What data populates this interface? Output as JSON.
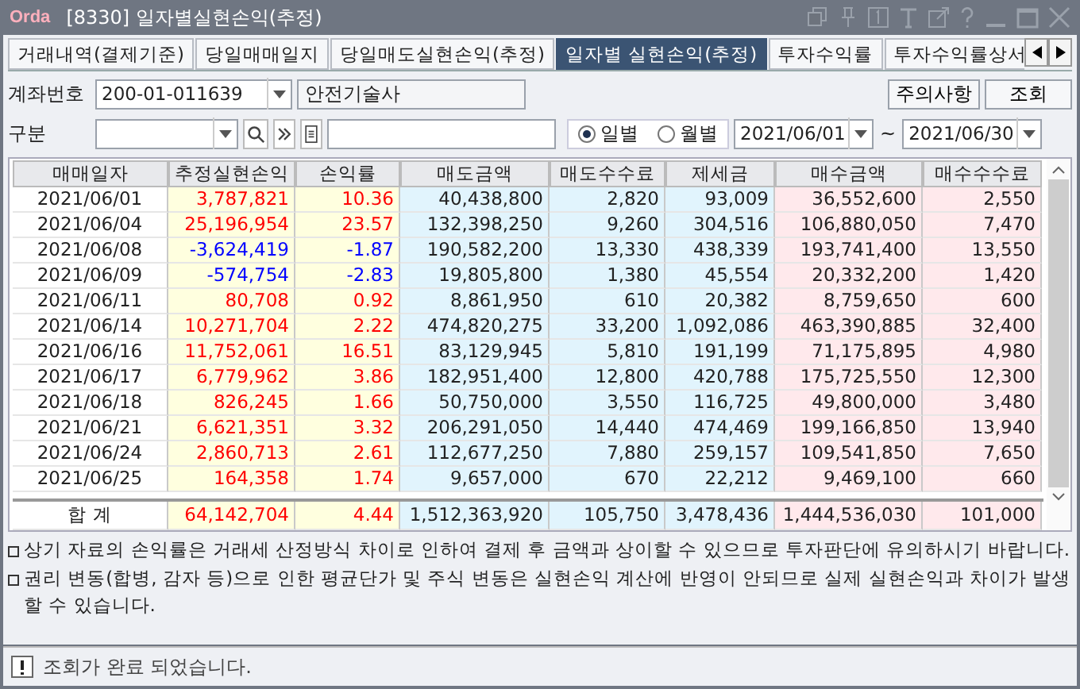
{
  "window": {
    "logo": "Orda",
    "title": "[8330] 일자별실현손익(추정)"
  },
  "tabs": [
    {
      "label": "거래내역(결제기준)",
      "selected": false
    },
    {
      "label": "당일매매일지",
      "selected": false
    },
    {
      "label": "당일매도실현손익(추정)",
      "selected": false
    },
    {
      "label": "일자별 실현손익(추정)",
      "selected": true
    },
    {
      "label": "투자수익률",
      "selected": false
    },
    {
      "label": "투자수익률상서",
      "selected": false
    }
  ],
  "account": {
    "label": "계좌번호",
    "number": "200-01-011639",
    "name": "안전기술사"
  },
  "buttons": [
    "주의사항",
    "조회"
  ],
  "filter": {
    "label": "구분",
    "period": [
      {
        "label": "일별",
        "selected": true
      },
      {
        "label": "월별",
        "selected": false
      }
    ],
    "from": "2021/06/01",
    "to": "2021/06/30",
    "separator": "~"
  },
  "table": {
    "columns": [
      "매매일자",
      "추정실현손익",
      "손익률",
      "매도금액",
      "매도수수료",
      "제세금",
      "매수금액",
      "매수수수료"
    ],
    "rows": [
      {
        "kind": "gain",
        "cells": [
          "2021/06/01",
          "3,787,821",
          "10.36",
          "40,438,800",
          "2,820",
          "93,009",
          "36,552,600",
          "2,550"
        ]
      },
      {
        "kind": "gain",
        "cells": [
          "2021/06/04",
          "25,196,954",
          "23.57",
          "132,398,250",
          "9,260",
          "304,516",
          "106,880,050",
          "7,470"
        ]
      },
      {
        "kind": "loss",
        "cells": [
          "2021/06/08",
          "-3,624,419",
          "-1.87",
          "190,582,200",
          "13,330",
          "438,339",
          "193,741,400",
          "13,550"
        ]
      },
      {
        "kind": "loss",
        "cells": [
          "2021/06/09",
          "-574,754",
          "-2.83",
          "19,805,800",
          "1,380",
          "45,554",
          "20,332,200",
          "1,420"
        ]
      },
      {
        "kind": "gain",
        "cells": [
          "2021/06/11",
          "80,708",
          "0.92",
          "8,861,950",
          "610",
          "20,382",
          "8,759,650",
          "600"
        ]
      },
      {
        "kind": "gain",
        "cells": [
          "2021/06/14",
          "10,271,704",
          "2.22",
          "474,820,275",
          "33,200",
          "1,092,086",
          "463,390,885",
          "32,400"
        ]
      },
      {
        "kind": "gain",
        "cells": [
          "2021/06/16",
          "11,752,061",
          "16.51",
          "83,129,945",
          "5,810",
          "191,199",
          "71,175,895",
          "4,980"
        ]
      },
      {
        "kind": "gain",
        "cells": [
          "2021/06/17",
          "6,779,962",
          "3.86",
          "182,951,400",
          "12,800",
          "420,788",
          "175,725,550",
          "12,300"
        ]
      },
      {
        "kind": "gain",
        "cells": [
          "2021/06/18",
          "826,245",
          "1.66",
          "50,750,000",
          "3,550",
          "116,725",
          "49,800,000",
          "3,480"
        ]
      },
      {
        "kind": "gain",
        "cells": [
          "2021/06/21",
          "6,621,351",
          "3.32",
          "206,291,050",
          "14,440",
          "474,469",
          "199,166,850",
          "13,940"
        ]
      },
      {
        "kind": "gain",
        "cells": [
          "2021/06/24",
          "2,860,713",
          "2.61",
          "112,677,250",
          "7,880",
          "259,157",
          "109,541,850",
          "7,650"
        ]
      },
      {
        "kind": "gain",
        "cells": [
          "2021/06/25",
          "164,358",
          "1.74",
          "9,657,000",
          "670",
          "22,212",
          "9,469,100",
          "660"
        ]
      }
    ],
    "total": {
      "kind": "gain",
      "cells": [
        "합 계",
        "64,142,704",
        "4.44",
        "1,512,363,920",
        "105,750",
        "3,478,436",
        "1,444,536,030",
        "101,000"
      ]
    }
  },
  "notes": [
    "상기 자료의 손익률은 거래세 산정방식 차이로 인하여 결제 후 금액과 상이할 수 있으므로 투자판단에 유의하시기 바랍니다.",
    "권리 변동(합병, 감자 등)으로 인한 평균단가 및 주식 변동은 실현손익 계산에 반영이 안되므로 실제 실현손익과 차이가 발생할 수 있습니다."
  ],
  "status": "조회가 완료 되었습니다."
}
